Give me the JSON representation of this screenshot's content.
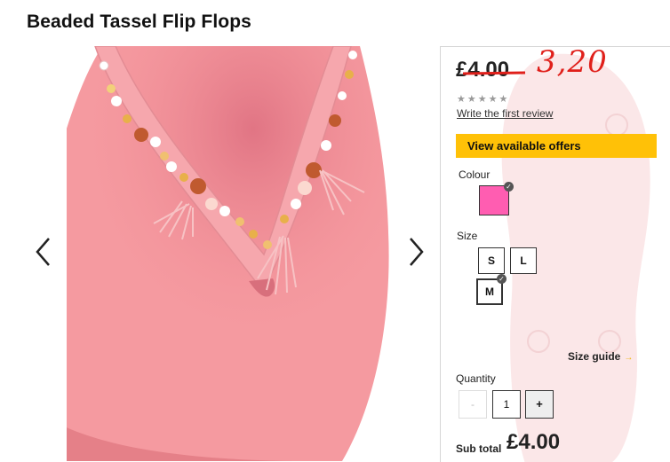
{
  "product": {
    "title": "Beaded Tassel Flip Flops"
  },
  "gallery": {
    "prev_icon": "chevron-left-icon",
    "next_icon": "chevron-right-icon",
    "image": "pink beaded tassel flip flop"
  },
  "price": {
    "old": "£4.00",
    "handwritten": "3,20",
    "handwritten_color": "#e0201b",
    "rating_stars": "★★★★★",
    "review_link": "Write the first review"
  },
  "offers": {
    "label": "View available offers",
    "color": "#ffc107"
  },
  "colour": {
    "label": "Colour",
    "selected_swatch": "#ff5db1"
  },
  "size": {
    "label": "Size",
    "options": [
      "S",
      "L",
      "M"
    ],
    "selected": "M",
    "guide_label": "Size guide",
    "guide_arrow": "→"
  },
  "quantity": {
    "label": "Quantity",
    "minus": "-",
    "value": "1",
    "plus": "+"
  },
  "subtotal": {
    "label": "Sub total",
    "value": "£4.00"
  }
}
